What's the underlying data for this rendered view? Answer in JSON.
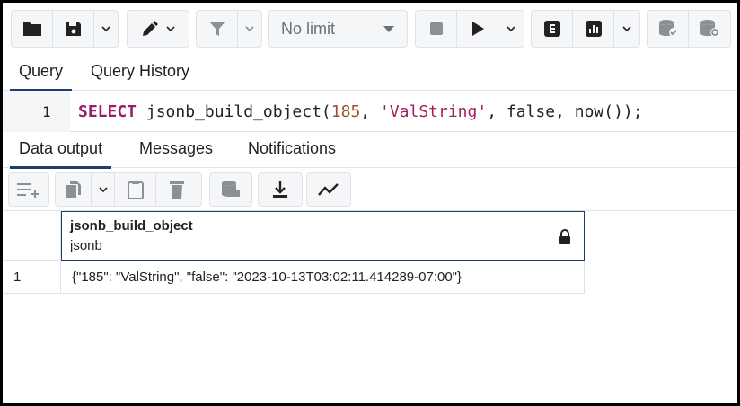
{
  "toolbar": {
    "limit_value": "No limit",
    "buttons": [
      "open-file",
      "save-file",
      "save-dropdown",
      "edit",
      "filter",
      "filter-dropdown",
      "stop",
      "execute",
      "execute-dropdown",
      "explain",
      "explain-analyze",
      "explain-dropdown",
      "commit",
      "rollback"
    ]
  },
  "query_tabs": [
    "Query",
    "Query History"
  ],
  "editor": {
    "line_number": "1",
    "code": {
      "kw": "SELECT",
      "fn": " jsonb_build_object(",
      "num": "185",
      "sep1": ", ",
      "str": "'ValString'",
      "rest": ", false, now());"
    }
  },
  "result_tabs": [
    "Data output",
    "Messages",
    "Notifications"
  ],
  "result_toolbar": {
    "buttons": [
      "add-row",
      "copy",
      "copy-dropdown",
      "paste",
      "delete",
      "save-data",
      "download",
      "graph"
    ]
  },
  "grid": {
    "column": {
      "name": "jsonb_build_object",
      "type": "jsonb"
    },
    "rows": [
      {
        "num": "1",
        "value": "{\"185\": \"ValString\", \"false\": \"2023-10-13T03:02:11.414289-07:00\"}"
      }
    ]
  },
  "colors": {
    "accent": "#1f3c6e",
    "keyword": "#9b1c6b",
    "string": "#a1225f",
    "number": "#a0522d"
  }
}
